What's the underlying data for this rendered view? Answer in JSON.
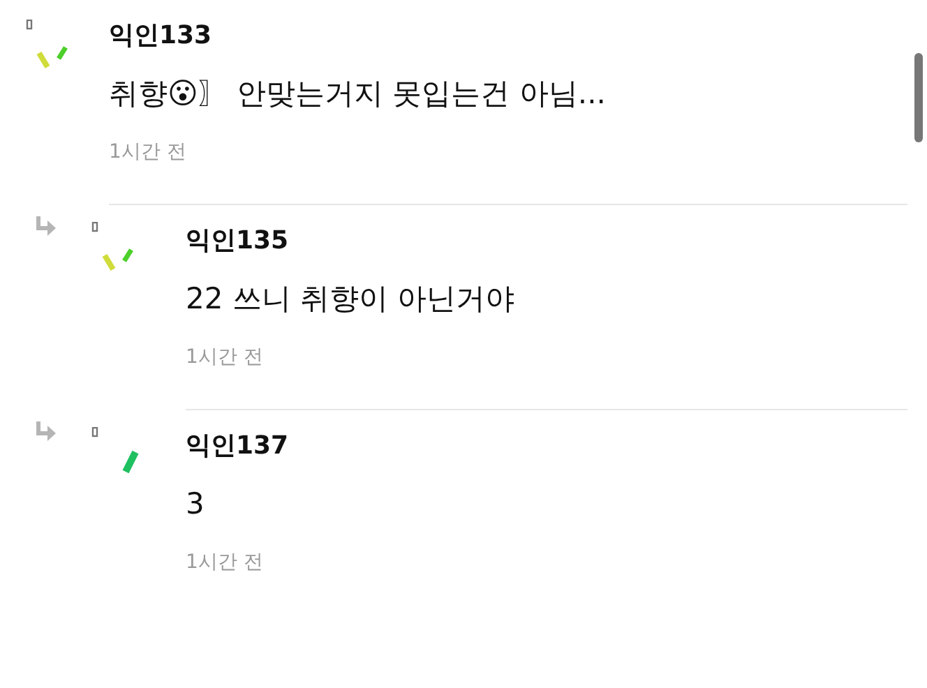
{
  "comments": [
    {
      "kind": "comment",
      "author": "익인133",
      "body": "취향😮〗 안맞는거지 못입는건 아님...",
      "time": "1시간 전",
      "avatar": {
        "kind": "pair"
      }
    },
    {
      "kind": "reply",
      "author": "익인135",
      "body": "22 쓰니 취향이 아닌거야",
      "time": "1시간 전",
      "avatar": {
        "kind": "pair"
      }
    },
    {
      "kind": "reply",
      "author": "익인137",
      "body": "3",
      "time": "1시간 전",
      "avatar": {
        "kind": "single"
      }
    }
  ]
}
